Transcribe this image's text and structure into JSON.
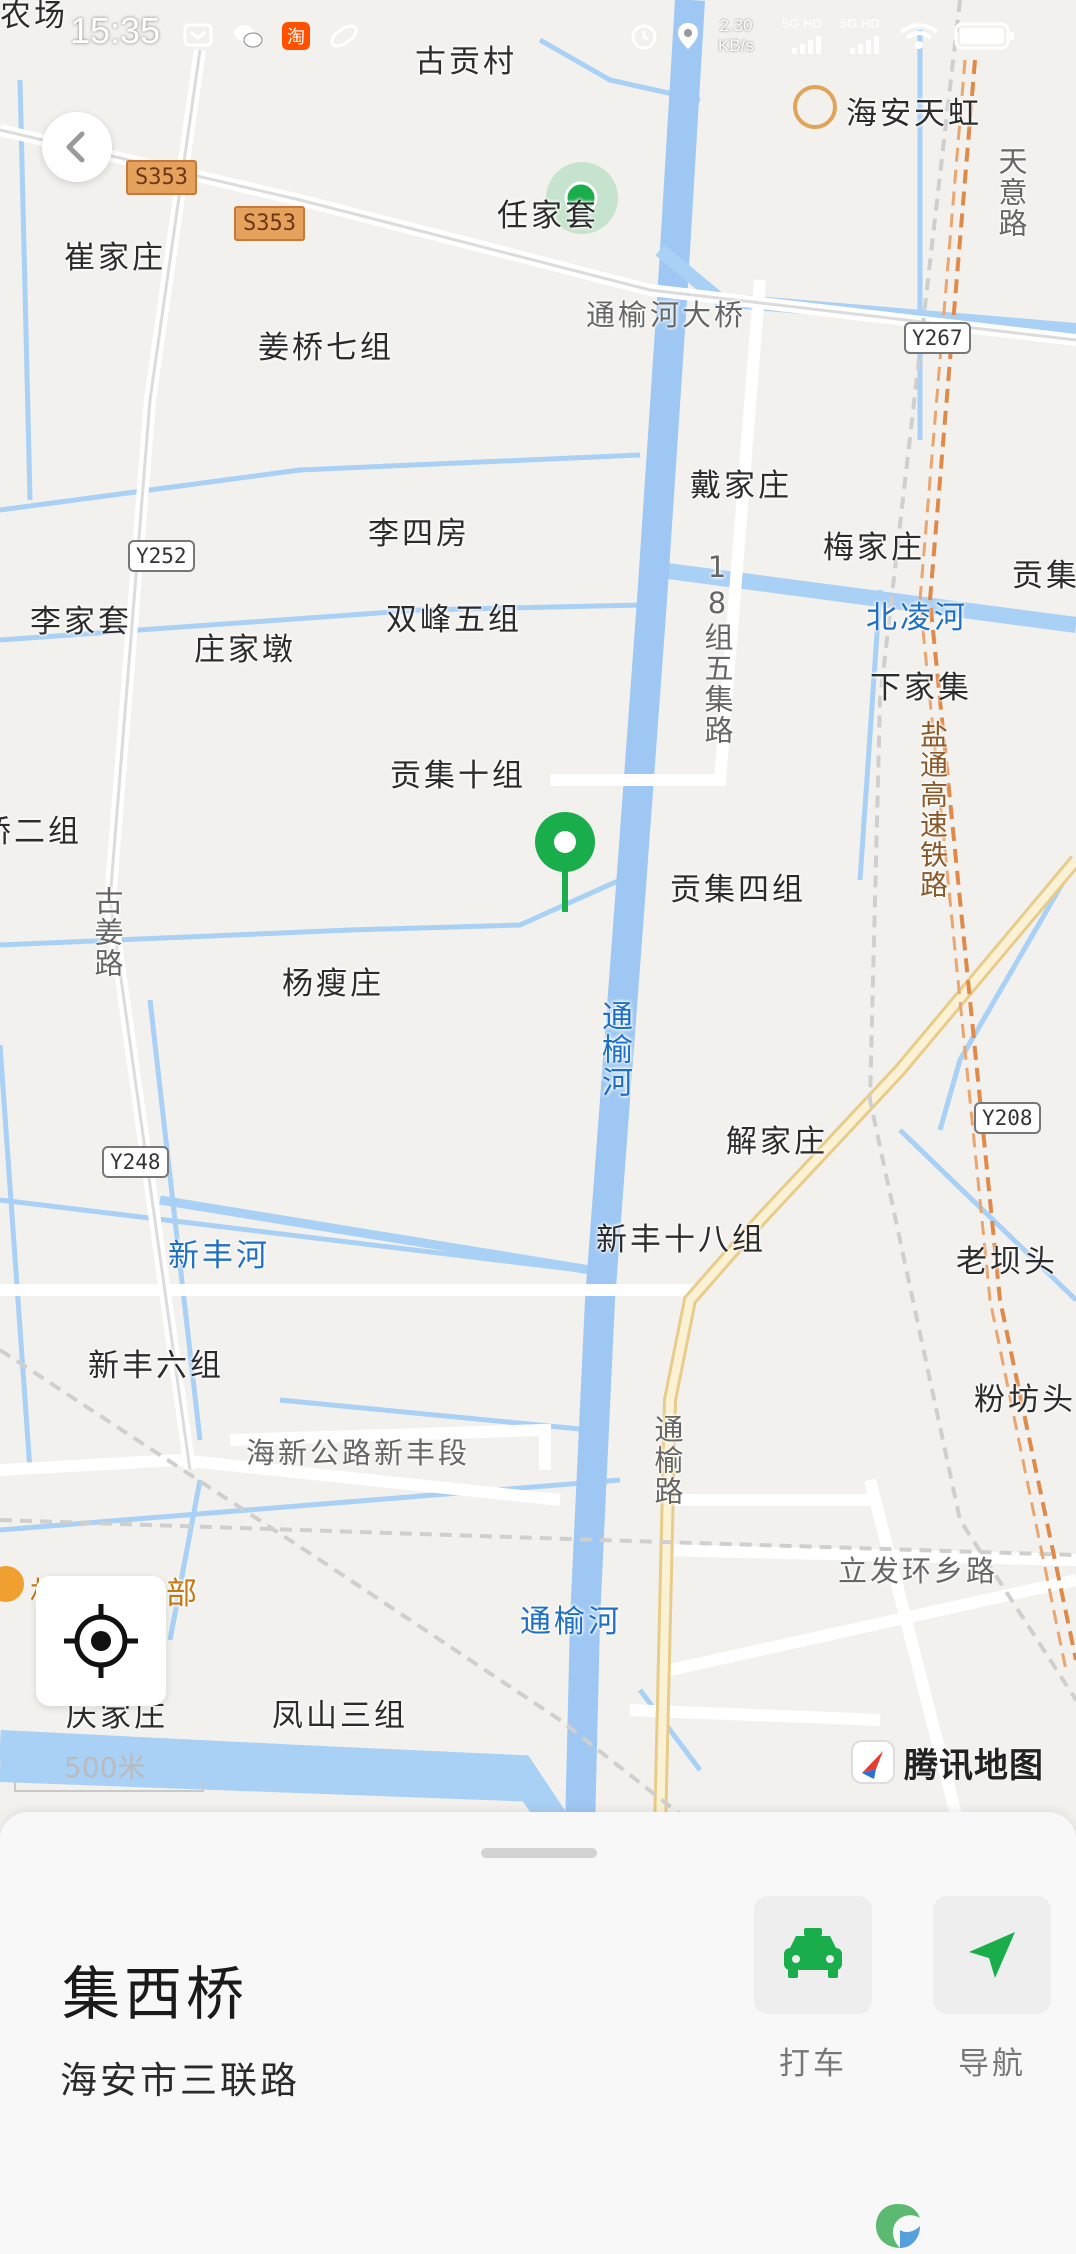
{
  "status_bar": {
    "time": "15:35",
    "net_speed": "2.30",
    "net_unit": "KB/s",
    "sim1": "5G HD",
    "sim2": "5G HD",
    "icons": [
      "sms-blocker-icon",
      "wechat-icon",
      "taobao-icon",
      "planet-icon",
      "alarm-icon",
      "location-icon",
      "signal-icon",
      "wifi-icon",
      "battery-icon"
    ]
  },
  "map": {
    "provider": "腾讯地图",
    "scale": "500米",
    "colors": {
      "land": "#f2f1ee",
      "water": "#a9d0f5",
      "river_main": "#9ec8f3",
      "pin": "#1aad4b",
      "rail": "#e08a4a"
    },
    "labels": {
      "top_left": "农场",
      "guigongcun": "古贡村",
      "haian_tianhong": "海安天虹",
      "renjiatao": "任家套",
      "cuijiazhuang": "崔家庄",
      "tongyuhe_bridge": "通榆河大桥",
      "tianyilu": "天意路",
      "jiangqiao7": "姜桥七组",
      "daijiazhuang": "戴家庄",
      "sisifang": "李四房",
      "meijiazhuang": "梅家庄",
      "gongji_r": "贡集",
      "lijiatao": "李家套",
      "shuangfeng5": "双峰五组",
      "zhuangjiadun": "庄家墩",
      "beilinghe": "北凌河",
      "road18": "18组五集路",
      "xiajiaji": "下家集",
      "gongji10": "贡集十组",
      "railway": "盐通高速铁路",
      "qiao2": "桥二组",
      "gongji4": "贡集四组",
      "gujianglu": "古姜路",
      "yangshouzhuang": "杨瘦庄",
      "tongyuhe_v": "通榆河",
      "xiejiazhuang": "解家庄",
      "xinfenghe": "新丰河",
      "xinfeng18": "新丰十八组",
      "laobatou": "老坝头",
      "xinfeng6": "新丰六组",
      "fenfangtou": "粉坊头",
      "haixin_road": "海新公路新丰段",
      "tongyulu": "通榆路",
      "lifa_road": "立发环乡路",
      "poi_orange": "机械参兵部",
      "tongyuhe_h": "通榆河",
      "fengshan3": "凤山三组",
      "qingjiazhuang": "庆家庄"
    },
    "shields": {
      "s353a": "S353",
      "s353b": "S353",
      "y267": "Y267",
      "y252": "Y252",
      "y248": "Y248",
      "y208": "Y208"
    }
  },
  "place": {
    "name": "集西桥",
    "address": "海安市三联路"
  },
  "actions": {
    "taxi_label": "打车",
    "navigate_label": "导航"
  }
}
